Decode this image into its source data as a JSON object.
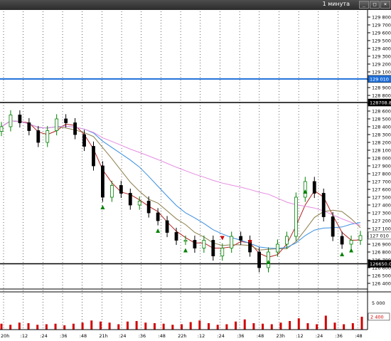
{
  "window": {
    "title": "1 минута",
    "minimize_icon": "minimize-icon",
    "maximize_icon": "maximize-icon",
    "close_icon": "close-icon"
  },
  "colors": {
    "up_candle": "#008000",
    "down_candle": "#000000",
    "ma_fast": "#b22222",
    "ma_mid": "#8b7d4b",
    "ma_slow": "#3b8fe0",
    "ma_long": "#e58de0",
    "blue_level": "#1e6fd9",
    "volume_bar": "#d00000",
    "grid": "#000000"
  },
  "price_axis": {
    "ticks": [
      "129 800",
      "129 700",
      "129 600",
      "129 500",
      "129 400",
      "129 300",
      "129 200",
      "129 100",
      "129 000",
      "128 900",
      "128 800",
      "128 700",
      "128 600",
      "128 500",
      "128 400",
      "128 300",
      "128 200",
      "128 100",
      "128 000",
      "127 900",
      "127 800",
      "127 700",
      "127 600",
      "127 500",
      "127 400",
      "127 300",
      "127 200",
      "127 100",
      "127 000",
      "126 900",
      "126 800",
      "126 700",
      "126 600",
      "126 500",
      "126 400"
    ],
    "level_labels": {
      "blue_level": "129 010",
      "upper_black_level": "128708.8",
      "current_price": "127 010",
      "lower_black_level": "126650.0"
    }
  },
  "volume_axis": {
    "ticks": [
      "5 000"
    ],
    "current_volume": "2 400"
  },
  "time_axis": {
    "labels": [
      "20h",
      ":12",
      ":24",
      ":36",
      ":48",
      "21h",
      ":24",
      ":36",
      ":48",
      "22h",
      ":12",
      ":24",
      ":36",
      ":48",
      "23h",
      ":12",
      ":24",
      ":36",
      ":48"
    ]
  },
  "chart_data": [
    {
      "type": "candlestick",
      "title": "",
      "xlabel": "",
      "ylabel": "",
      "ylim": [
        126400,
        129800
      ],
      "grid": true,
      "x": [
        "20h",
        ":12",
        ":24",
        ":36",
        ":48",
        "21h",
        ":24",
        ":36",
        ":48",
        "22h",
        ":12",
        ":24",
        ":36",
        ":48",
        "23h",
        ":12",
        ":24",
        ":36",
        ":48"
      ],
      "horizontal_levels": [
        129010,
        128708.8,
        126650.0
      ],
      "close_approx": [
        128400,
        128550,
        128450,
        128350,
        128200,
        128350,
        128500,
        128450,
        128300,
        128150,
        127900,
        127500,
        127650,
        127550,
        127400,
        127450,
        127300,
        127200,
        127050,
        126950,
        126950,
        126850,
        126950,
        126750,
        126850,
        127000,
        126950,
        126800,
        126600,
        126800,
        126900,
        127000,
        127500,
        127700,
        127550,
        127250,
        127000,
        126900,
        126950,
        127010
      ]
    },
    {
      "type": "bar",
      "title": "",
      "ylim": [
        0,
        6500
      ],
      "series": [
        {
          "values_approx": [
            1100,
            900,
            1300,
            1200,
            900,
            1000,
            1100,
            800,
            1100,
            1300,
            1700,
            1500,
            1300,
            1000,
            1500,
            1600,
            1300,
            1200,
            1100,
            900,
            1000,
            1400,
            1700,
            1200,
            900,
            1000,
            1500,
            1900,
            1200,
            1100,
            1000,
            1300,
            1600,
            2100,
            1200,
            1000,
            2600,
            1300,
            1000,
            1200,
            2400
          ]
        }
      ]
    }
  ]
}
